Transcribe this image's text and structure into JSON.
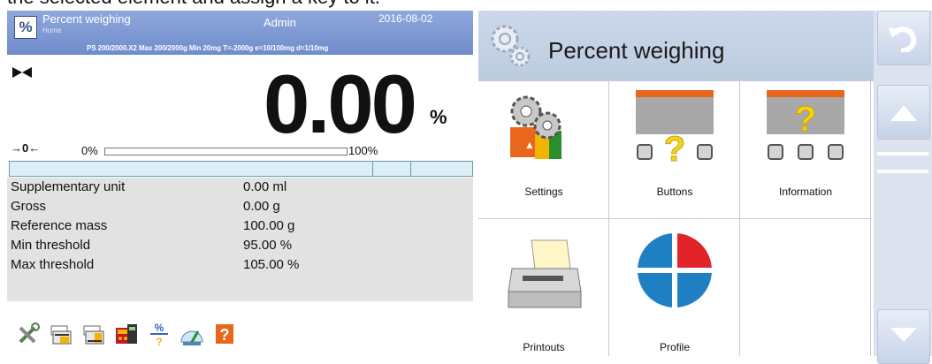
{
  "caption": "the selected element and assign a key to it.",
  "left_screen": {
    "header": {
      "mode_icon": "%",
      "title": "Percent weighing",
      "subtitle": "Home",
      "user": "Admin",
      "date": "2016-08-02",
      "spec": "PS 200/2000.X2  Max 200/2000g  Min 20mg  T=-2000g  e=10/100mg  d=1/10mg"
    },
    "display": {
      "zero_indicator": "→0←",
      "reading": "0.00",
      "unit": "%",
      "bar_min_label": "0%",
      "bar_max_label": "100%",
      "bar_fill_fraction": 0.0
    },
    "info_rows": [
      {
        "label": "Supplementary unit",
        "value": "0.00 ml"
      },
      {
        "label": "Gross",
        "value": "0.00 g"
      },
      {
        "label": "Reference mass",
        "value": "100.00 g"
      },
      {
        "label": "Min threshold",
        "value": "95.00 %"
      },
      {
        "label": "Max threshold",
        "value": "105.00 %"
      }
    ],
    "toolbar_icons": [
      "settings-icon",
      "print-header-icon",
      "print-footer-icon",
      "calculator-icon",
      "percent-reference-icon",
      "gauge-icon",
      "help-icon"
    ]
  },
  "right_screen": {
    "title": "Percent weighing",
    "header_icon": "settings-gear-icon",
    "menu": [
      {
        "label": "Settings",
        "icon": "settings-icon"
      },
      {
        "label": "Buttons",
        "icon": "buttons-icon"
      },
      {
        "label": "Information",
        "icon": "information-icon"
      },
      {
        "label": "Printouts",
        "icon": "printer-icon"
      },
      {
        "label": "Profile",
        "icon": "profile-icon"
      }
    ],
    "side_buttons": [
      "undo-icon",
      "home-icon",
      "scroll-down-icon"
    ]
  },
  "colors": {
    "header_blue": "#7b95d2",
    "info_grey": "#e2e2e2",
    "profile_red": "#e2232a",
    "profile_blue": "#1f7fc3",
    "accent_orange": "#e8671c"
  }
}
